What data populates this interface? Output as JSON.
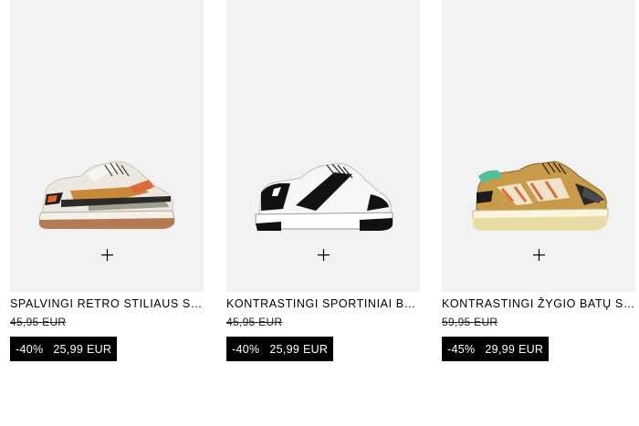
{
  "products": [
    {
      "name": "SPALVINGI RETRO STILIAUS SPORT...",
      "old_price": "45,95 EUR",
      "discount": "-40%",
      "price": "25,99 EUR",
      "add_icon": "plus-icon",
      "image_icon": "sneaker-image"
    },
    {
      "name": "KONTRASTINGI SPORTINIAI BATELIAI",
      "old_price": "45,95 EUR",
      "discount": "-40%",
      "price": "25,99 EUR",
      "add_icon": "plus-icon",
      "image_icon": "sneaker-image"
    },
    {
      "name": "KONTRASTINGI ŽYGIO BATŲ STILIA...",
      "old_price": "59,95 EUR",
      "discount": "-45%",
      "price": "29,99 EUR",
      "add_icon": "plus-icon",
      "image_icon": "sneaker-image"
    }
  ],
  "colors": {
    "image_background": "#f2f2f2",
    "price_tag_background": "#000000",
    "price_tag_text": "#ffffff"
  }
}
